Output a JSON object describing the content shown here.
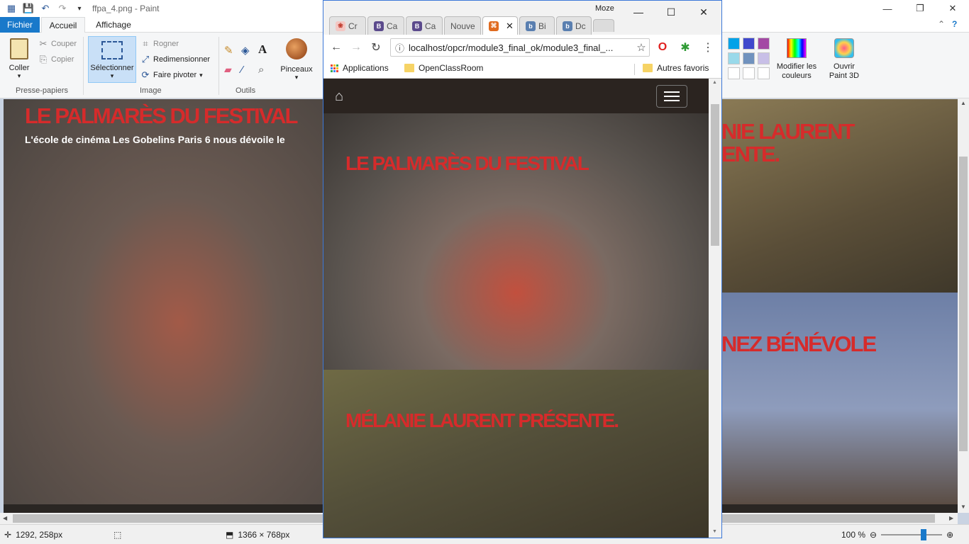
{
  "paint": {
    "title": "ffpa_4.png - Paint",
    "tabs": {
      "file": "Fichier",
      "home": "Accueil",
      "view": "Affichage"
    },
    "clipboard": {
      "paste": "Coller",
      "cut": "Couper",
      "copy": "Copier",
      "group": "Presse-papiers"
    },
    "image": {
      "select": "Sélectionner",
      "crop": "Rogner",
      "resize": "Redimensionner",
      "rotate": "Faire pivoter",
      "group": "Image"
    },
    "tools": {
      "group": "Outils"
    },
    "brushes": "Pinceaux",
    "edit_colors": "Modifier les couleurs",
    "paint3d": "Ouvrir Paint 3D",
    "palette": [
      "#00a2e8",
      "#3f48cc",
      "#a349a4",
      "#99d9ea",
      "#7092be",
      "#c8bfe7",
      "#ffffff",
      "#ffffff",
      "#ffffff"
    ],
    "status": {
      "cursor": "1292, 258px",
      "dimensions": "1366 × 768px",
      "zoom": "100 %"
    },
    "canvas": {
      "left_title": "LE PALMARÈS DU FESTIVAL",
      "left_subtitle": "L'école de cinéma Les Gobelins Paris 6 nous dévoile le",
      "right_title_1": "NIE LAURENT",
      "right_title_1b": "ENTE.",
      "right_title_2": "NEZ BÉNÉVOLE"
    }
  },
  "chrome": {
    "profile": "Moze",
    "tabs": [
      {
        "label": "Cr",
        "fav": "#e06666",
        "glyph": ""
      },
      {
        "label": "Ca",
        "fav": "#5b4a8c",
        "glyph": "B"
      },
      {
        "label": "Ca",
        "fav": "#5b4a8c",
        "glyph": "B"
      },
      {
        "label": "Nouve",
        "fav": "",
        "glyph": ""
      },
      {
        "label": "",
        "fav": "#e06b20",
        "glyph": "⌘"
      },
      {
        "label": "Bi",
        "fav": "#5a7fb0",
        "glyph": "b"
      },
      {
        "label": "Dc",
        "fav": "#5a7fb0",
        "glyph": "b"
      }
    ],
    "url": "localhost/opcr/module3_final_ok/module3_final_...",
    "bookmarks": {
      "apps": "Applications",
      "folder1": "OpenClassRoom",
      "other": "Autres favoris"
    },
    "page": {
      "hero1_title": "LE PALMARÈS DU FESTIVAL",
      "hero2_title": "MÉLANIE LAURENT PRÉSENTE."
    }
  }
}
